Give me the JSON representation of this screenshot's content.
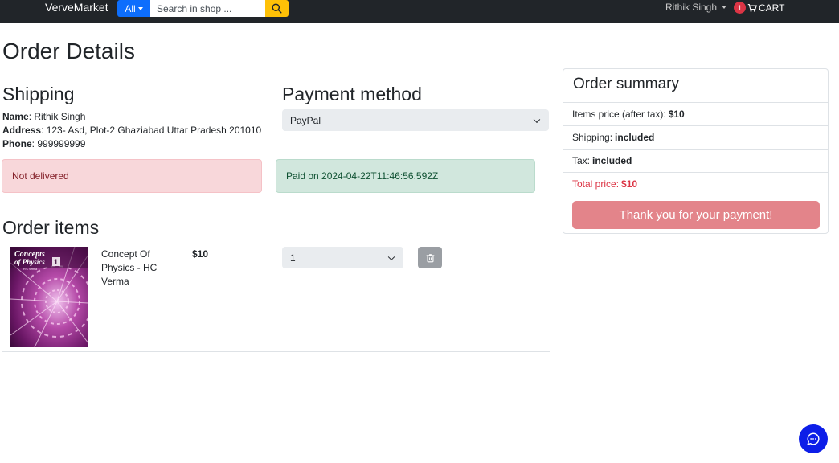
{
  "navbar": {
    "brand": "VerveMarket",
    "category_label": "All",
    "search_placeholder": "Search in shop ...",
    "user_name": "Rithik Singh",
    "cart_count": "1",
    "cart_label": "CART"
  },
  "page": {
    "title": "Order Details"
  },
  "shipping": {
    "heading": "Shipping",
    "name_label": "Name",
    "name_value": ": Rithik Singh",
    "address_label": "Address",
    "address_value": ": 123- Asd, Plot-2 Ghaziabad Uttar Pradesh 201010",
    "phone_label": "Phone",
    "phone_value": ": 999999999",
    "delivery_status": "Not delivered"
  },
  "payment": {
    "heading": "Payment method",
    "method": "PayPal",
    "status": "Paid on 2024-04-22T11:46:56.592Z"
  },
  "order_items": {
    "heading": "Order items",
    "items": [
      {
        "name": "Concept Of Physics - HC Verma",
        "price": "$10",
        "quantity": "1",
        "cover_title_1": "Concepts",
        "cover_title_2": "of Physics",
        "cover_volume": "1",
        "cover_author": "H C Verma"
      }
    ]
  },
  "summary": {
    "title": "Order summary",
    "items_label": "Items price (after tax):",
    "items_value": "$10",
    "shipping_label": "Shipping:",
    "shipping_value": "included",
    "tax_label": "Tax:",
    "tax_value": "included",
    "total_label": "Total price:",
    "total_value": "$10",
    "paid_button": "Thank you for your payment!"
  },
  "colors": {
    "navbar_bg": "#212529",
    "primary": "#0d6efd",
    "warning": "#ffc107",
    "danger": "#dc3545",
    "paid_button": "#e3848a",
    "chat_button": "#0d1ee8"
  },
  "icons": {
    "search": "search-icon",
    "cart": "cart-icon",
    "delete": "trash-icon",
    "chat": "chat-icon"
  }
}
